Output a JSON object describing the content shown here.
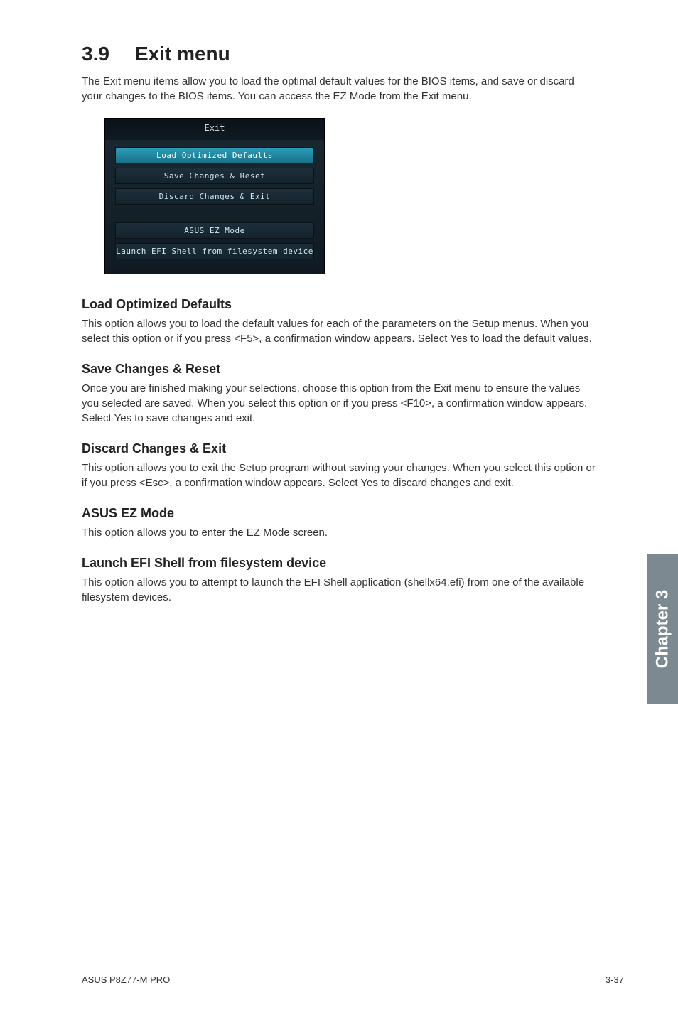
{
  "heading": {
    "number": "3.9",
    "title": "Exit menu"
  },
  "intro": "The Exit menu items allow you to load the optimal default values for the BIOS items, and save or discard your changes to the BIOS items. You can access the EZ Mode from the Exit menu.",
  "bios": {
    "header": "Exit",
    "buttons": [
      "Load Optimized Defaults",
      "Save Changes & Reset",
      "Discard Changes & Exit"
    ],
    "buttons2": [
      "ASUS EZ Mode",
      "Launch EFI Shell from filesystem device"
    ]
  },
  "sections": [
    {
      "title": "Load Optimized Defaults",
      "body": "This option allows you to load the default values for each of the parameters on the Setup menus. When you select this option or if you press <F5>, a confirmation window appears. Select Yes to load the default values."
    },
    {
      "title": "Save Changes & Reset",
      "body": "Once you are finished making your selections, choose this option from the Exit menu to ensure the values you selected are saved. When you select this option or if you press <F10>, a confirmation window appears. Select Yes to save changes and exit."
    },
    {
      "title": "Discard Changes & Exit",
      "body": "This option allows you to exit the Setup program without saving your changes. When you select this option or if you press <Esc>, a confirmation window appears. Select Yes to discard changes and exit."
    },
    {
      "title": "ASUS EZ Mode",
      "body": "This option allows you to enter the EZ Mode screen."
    },
    {
      "title": "Launch EFI Shell from filesystem device",
      "body": "This option allows you to attempt to launch the EFI Shell application (shellx64.efi) from one of the available filesystem devices."
    }
  ],
  "chapterTab": "Chapter 3",
  "footer": {
    "left": "ASUS P8Z77-M PRO",
    "right": "3-37"
  }
}
